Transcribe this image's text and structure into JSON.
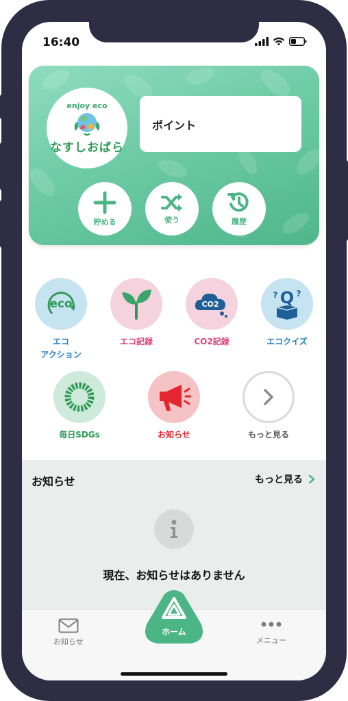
{
  "status_bar": {
    "time": "16:40"
  },
  "app": {
    "logo_top": "enjoy eco",
    "logo_bottom": "なすしおばら"
  },
  "points": {
    "label": "ポイント"
  },
  "actions": [
    {
      "label": "貯める",
      "icon": "plus-icon"
    },
    {
      "label": "使う",
      "icon": "shuffle-icon"
    },
    {
      "label": "履歴",
      "icon": "history-icon"
    }
  ],
  "menu": [
    {
      "label_line1": "エコ",
      "label_line2": "アクション",
      "icon": "eco-action-icon",
      "color": "#2b7fc0",
      "bg": "#c6e3f2"
    },
    {
      "label_line1": "エコ記録",
      "label_line2": "",
      "icon": "sprout-icon",
      "color": "#e0437c",
      "bg": "#f5d3de"
    },
    {
      "label_line1": "CO2記録",
      "label_line2": "",
      "icon": "co2-cloud-icon",
      "color": "#e0437c",
      "bg": "#f5d3de"
    },
    {
      "label_line1": "エコクイズ",
      "label_line2": "",
      "icon": "quiz-box-icon",
      "color": "#2b7fc0",
      "bg": "#c6e3f2"
    },
    {
      "label_line1": "毎日SDGs",
      "label_line2": "",
      "icon": "sdgs-wheel-icon",
      "color": "#2f9a55",
      "bg": "#cdeadb"
    },
    {
      "label_line1": "お知らせ",
      "label_line2": "",
      "icon": "megaphone-icon",
      "color": "#e3262f",
      "bg": "#f5c3c6"
    },
    {
      "label_line1": "もっと見る",
      "label_line2": "",
      "icon": "chevron-right-icon",
      "color": "#555555",
      "bg": "#ffffff"
    }
  ],
  "news": {
    "title": "お知らせ",
    "more_label": "もっと見る",
    "empty_message": "現在、お知らせはありません"
  },
  "tabs": {
    "left": "お知らせ",
    "center": "ホーム",
    "right": "メニュー"
  },
  "colors": {
    "brand_green": "#4bb585",
    "frame": "#2e2d43"
  }
}
